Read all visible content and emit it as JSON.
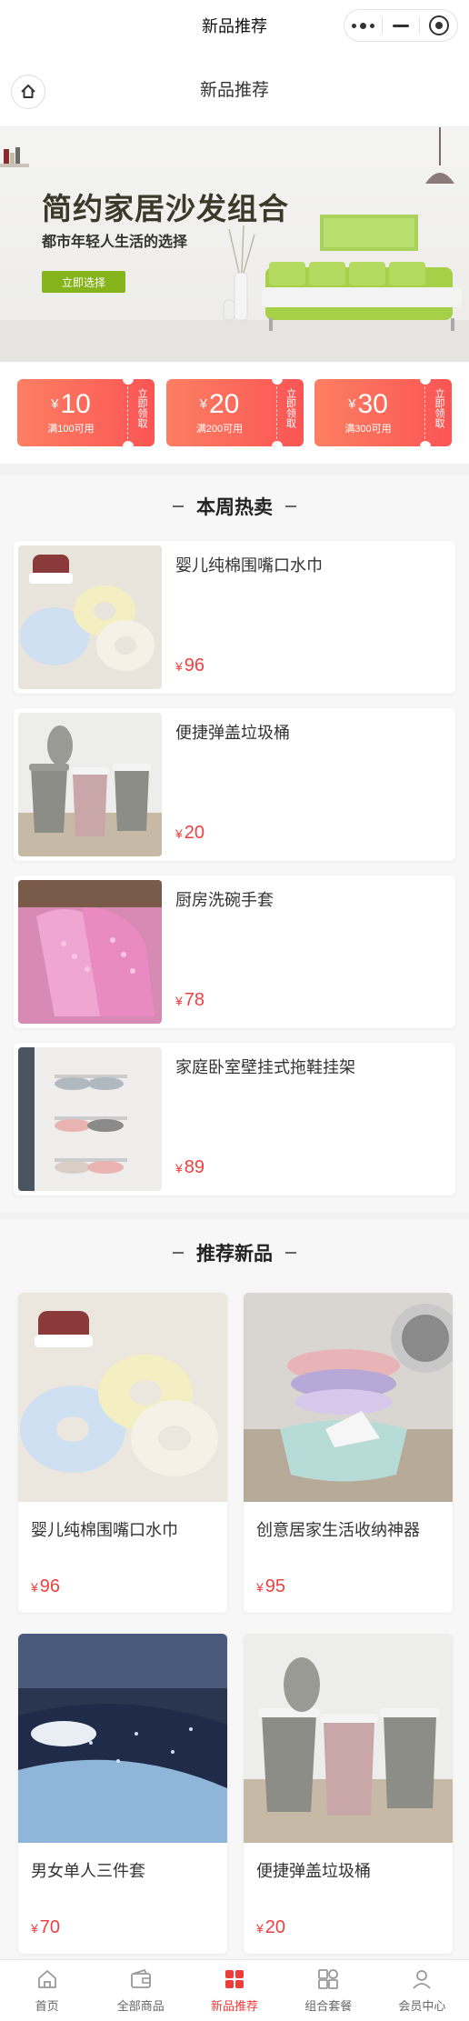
{
  "statusbar": {
    "title": "新品推荐"
  },
  "navbar": {
    "title": "新品推荐"
  },
  "banner": {
    "title": "简约家居沙发组合",
    "subtitle": "都市年轻人生活的选择",
    "button": "立即选择",
    "accent": "#86b41b"
  },
  "coupons": [
    {
      "symbol": "¥",
      "amount": "10",
      "condition": "满100可用",
      "action": "立即领取"
    },
    {
      "symbol": "¥",
      "amount": "20",
      "condition": "满200可用",
      "action": "立即领取"
    },
    {
      "symbol": "¥",
      "amount": "30",
      "condition": "满300可用",
      "action": "立即领取"
    }
  ],
  "hot": {
    "title": "本周热卖",
    "items": [
      {
        "name": "婴儿纯棉围嘴口水巾",
        "currency": "¥",
        "price": "96",
        "image": "bibs-image"
      },
      {
        "name": "便捷弹盖垃圾桶",
        "currency": "¥",
        "price": "20",
        "image": "trash-bins-image"
      },
      {
        "name": "厨房洗碗手套",
        "currency": "¥",
        "price": "78",
        "image": "pink-gloves-image"
      },
      {
        "name": "家庭卧室壁挂式拖鞋挂架",
        "currency": "¥",
        "price": "89",
        "image": "slipper-rack-image"
      }
    ]
  },
  "recommend": {
    "title": "推荐新品",
    "items": [
      {
        "name": "婴儿纯棉围嘴口水巾",
        "currency": "¥",
        "price": "96",
        "image": "bibs-image"
      },
      {
        "name": "创意居家生活收纳神器",
        "currency": "¥",
        "price": "95",
        "image": "folding-basins-image"
      },
      {
        "name": "男女单人三件套",
        "currency": "¥",
        "price": "70",
        "image": "bedding-image"
      },
      {
        "name": "便捷弹盖垃圾桶",
        "currency": "¥",
        "price": "20",
        "image": "trash-bins-image"
      }
    ]
  },
  "tabbar": {
    "active_color": "#f03b3b",
    "items": [
      {
        "label": "首页",
        "icon": "home-icon"
      },
      {
        "label": "全部商品",
        "icon": "wallet-icon"
      },
      {
        "label": "新品推荐",
        "icon": "grid-icon",
        "active": true
      },
      {
        "label": "组合套餐",
        "icon": "combo-icon"
      },
      {
        "label": "会员中心",
        "icon": "user-icon"
      }
    ]
  }
}
